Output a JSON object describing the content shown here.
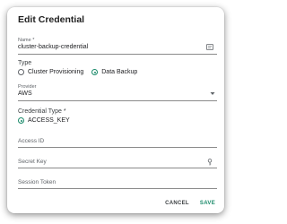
{
  "dialog": {
    "title": "Edit Credential",
    "name_field": {
      "label": "Name *",
      "value": "cluster-backup-credential"
    },
    "type_section": {
      "label": "Type",
      "options": [
        {
          "label": "Cluster Provisioning",
          "selected": false
        },
        {
          "label": "Data Backup",
          "selected": true
        }
      ]
    },
    "provider_field": {
      "label": "Provider",
      "value": "AWS"
    },
    "credential_type_section": {
      "label": "Credential Type *",
      "options": [
        {
          "label": "ACCESS_KEY",
          "selected": true
        }
      ]
    },
    "access_id_field": {
      "label": "Access ID",
      "value": ""
    },
    "secret_key_field": {
      "label": "Secret Key",
      "value": ""
    },
    "session_token_field": {
      "label": "Session Token",
      "value": ""
    },
    "actions": {
      "cancel_label": "CANCEL",
      "save_label": "SAVE"
    }
  },
  "colors": {
    "accent": "#1a8a6a",
    "text": "#202124",
    "muted": "#5f6368"
  },
  "icons": {
    "name_field_icon": "id-card-icon",
    "provider_dropdown_icon": "caret-down-icon",
    "secret_key_icon": "key-icon"
  }
}
